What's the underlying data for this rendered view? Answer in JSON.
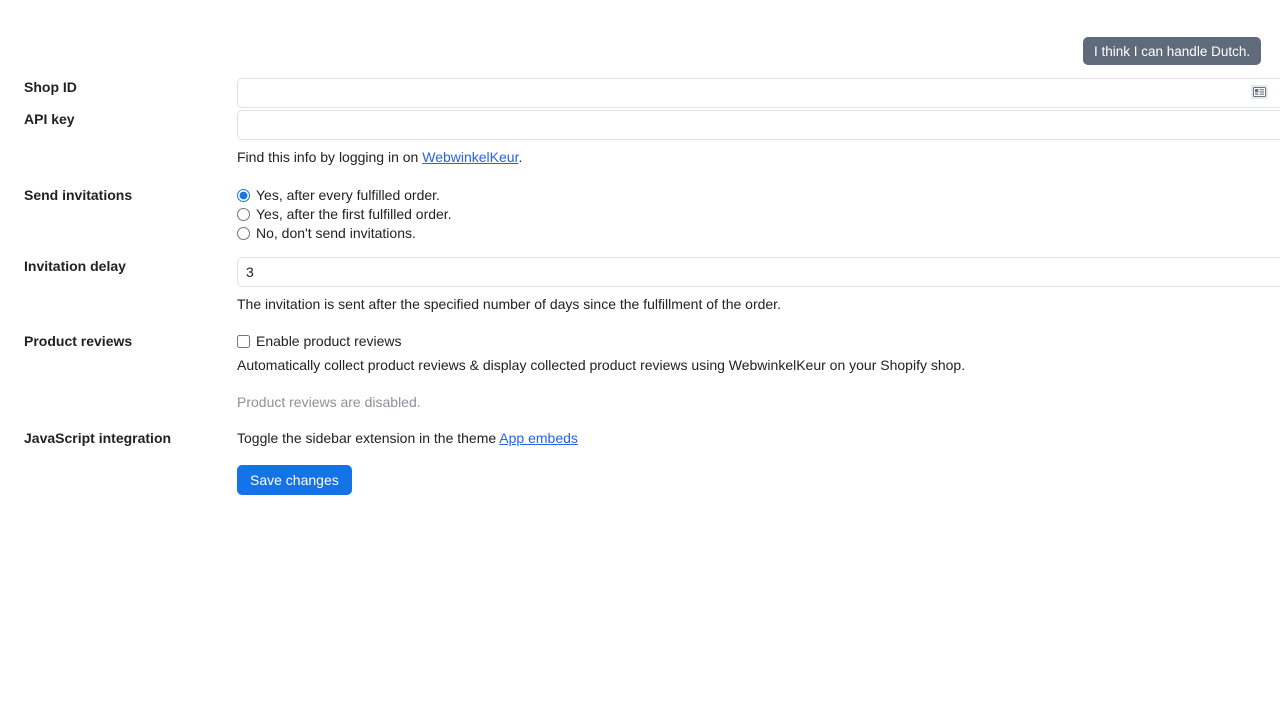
{
  "language_badge": {
    "label": "I think I can handle Dutch.",
    "bg_color": "#5f6b7a",
    "text_color": "#ffffff"
  },
  "theme": {
    "primary_button_color": "#1473e6",
    "link_color": "#2563eb",
    "muted_text_color": "#8c9196",
    "input_border_color": "#dfe3e8"
  },
  "form": {
    "shop_id": {
      "label": "Shop ID",
      "value": "",
      "placeholder": "",
      "autofill_icon": "contact-card-icon"
    },
    "api_key": {
      "label": "API key",
      "value": "",
      "placeholder": ""
    },
    "credentials_help": {
      "prefix": "Find this info by logging in on ",
      "link_text": "WebwinkelKeur",
      "suffix": "."
    },
    "send_invitations": {
      "label": "Send invitations",
      "options": [
        {
          "label": "Yes, after every fulfilled order.",
          "selected": true
        },
        {
          "label": "Yes, after the first fulfilled order.",
          "selected": false
        },
        {
          "label": "No, don't send invitations.",
          "selected": false
        }
      ]
    },
    "invitation_delay": {
      "label": "Invitation delay",
      "value": "3",
      "help": "The invitation is sent after the specified number of days since the fulfillment of the order."
    },
    "product_reviews": {
      "label": "Product reviews",
      "checkbox_label": "Enable product reviews",
      "checked": false,
      "help": "Automatically collect product reviews & display collected product reviews using WebwinkelKeur on your Shopify shop.",
      "status": "Product reviews are disabled."
    },
    "javascript_integration": {
      "label": "JavaScript integration",
      "text_prefix": "Toggle the sidebar extension in the theme ",
      "link_text": "App embeds"
    },
    "save_button": "Save changes"
  }
}
